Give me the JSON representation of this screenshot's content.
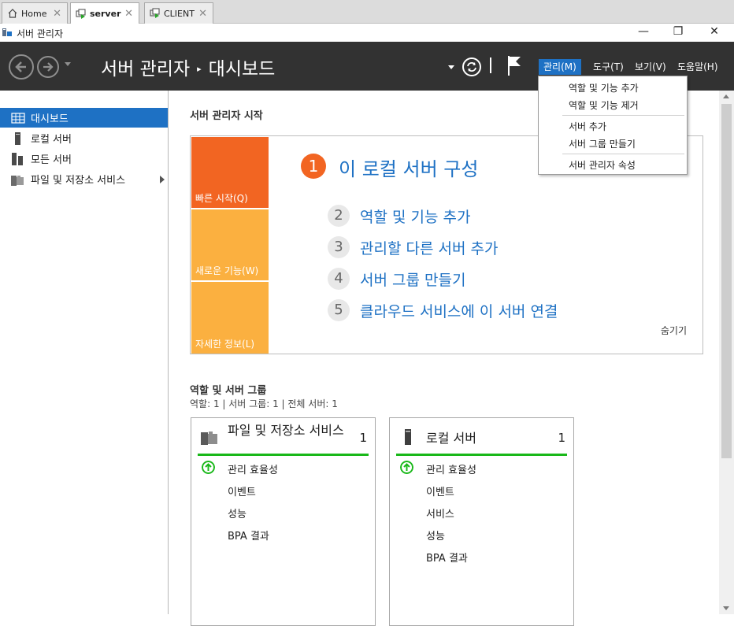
{
  "vm_tabs": [
    {
      "label": "Home"
    },
    {
      "label": "server"
    },
    {
      "label": "CLIENT"
    }
  ],
  "window": {
    "title": "서버 관리자",
    "minimize": "—",
    "maximize": "❐",
    "close": "✕"
  },
  "header": {
    "app_name": "서버 관리자",
    "separator": "▸",
    "page": "대시보드",
    "menus": [
      "관리(M)",
      "도구(T)",
      "보기(V)",
      "도움말(H)"
    ]
  },
  "manage_menu": {
    "items": [
      "역할 및 기능 추가",
      "역할 및 기능 제거",
      "서버 추가",
      "서버 그룹 만들기",
      "서버 관리자 속성"
    ]
  },
  "sidebar": {
    "items": [
      {
        "label": "대시보드",
        "icon": "dashboard-icon"
      },
      {
        "label": "로컬 서버",
        "icon": "server-icon"
      },
      {
        "label": "모든 서버",
        "icon": "servers-icon"
      },
      {
        "label": "파일 및 저장소 서비스",
        "icon": "file-storage-icon"
      }
    ]
  },
  "quick_start": {
    "section_title": "서버 관리자 시작",
    "tiles": [
      "빠른 시작(Q)",
      "새로운 기능(W)",
      "자세한 정보(L)"
    ],
    "step1": {
      "num": "1",
      "text": "이 로컬 서버 구성"
    },
    "steps": [
      {
        "num": "2",
        "text": "역할 및 기능 추가"
      },
      {
        "num": "3",
        "text": "관리할 다른 서버 추가"
      },
      {
        "num": "4",
        "text": "서버 그룹 만들기"
      },
      {
        "num": "5",
        "text": "클라우드 서비스에 이 서버 연결"
      }
    ],
    "hide": "숨기기"
  },
  "groups": {
    "section_title": "역할 및 서버 그룹",
    "stats": "역할: 1   |   서버 그룹: 1   |   전체 서버: 1",
    "cards": [
      {
        "title": "파일 및 저장소 서비스",
        "count": "1",
        "rows": [
          "관리 효율성",
          "이벤트",
          "성능",
          "BPA 결과"
        ]
      },
      {
        "title": "로컬 서버",
        "count": "1",
        "rows": [
          "관리 효율성",
          "이벤트",
          "서비스",
          "성능",
          "BPA 결과"
        ]
      }
    ]
  },
  "colors": {
    "header_bg": "#323232",
    "accent_blue": "#1e71c4",
    "tile_orange": "#f26522",
    "tile_amber": "#fbb040",
    "status_green": "#19b819"
  }
}
